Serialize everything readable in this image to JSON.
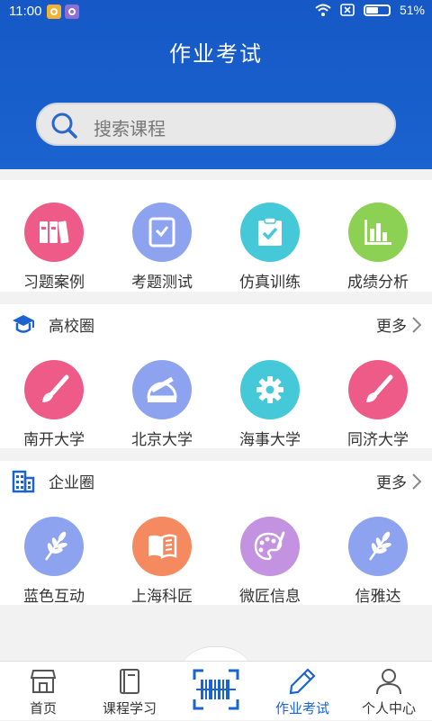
{
  "status_bar": {
    "time": "11:00",
    "battery": "51%"
  },
  "header": {
    "title": "作业考试"
  },
  "search": {
    "placeholder": "搜索课程"
  },
  "quick_actions": [
    {
      "label": "习题案例",
      "color": "#ee5b88",
      "icon": "books-icon"
    },
    {
      "label": "考题测试",
      "color": "#8ea3f0",
      "icon": "tablet-check-icon"
    },
    {
      "label": "仿真训练",
      "color": "#45c9d8",
      "icon": "clipboard-check-icon"
    },
    {
      "label": "成绩分析",
      "color": "#8cd054",
      "icon": "bar-chart-icon"
    }
  ],
  "universities": {
    "title": "高校圈",
    "more": "更多",
    "items": [
      {
        "label": "南开大学",
        "color": "#ee5b88",
        "icon": "paintbrush-icon"
      },
      {
        "label": "北京大学",
        "color": "#8ea3f0",
        "icon": "ruler-protractor-icon"
      },
      {
        "label": "海事大学",
        "color": "#45c9d8",
        "icon": "gear-icon"
      },
      {
        "label": "同济大学",
        "color": "#ee5b88",
        "icon": "paintbrush-icon"
      }
    ]
  },
  "companies": {
    "title": "企业圈",
    "more": "更多",
    "items": [
      {
        "label": "蓝色互动",
        "color": "#8ea3f0",
        "icon": "wheat-icon"
      },
      {
        "label": "上海科匠",
        "color": "#f5895f",
        "icon": "open-book-icon"
      },
      {
        "label": "微匠信息",
        "color": "#c392e0",
        "icon": "palette-icon"
      },
      {
        "label": "信雅达",
        "color": "#8ea3f0",
        "icon": "wheat-icon"
      }
    ]
  },
  "bottom_nav": [
    {
      "label": "首页",
      "icon": "shop-icon"
    },
    {
      "label": "课程学习",
      "icon": "book-icon"
    },
    {
      "label": "",
      "icon": "barcode-scan-icon"
    },
    {
      "label": "作业考试",
      "icon": "pencil-icon"
    },
    {
      "label": "个人中心",
      "icon": "user-icon"
    }
  ]
}
